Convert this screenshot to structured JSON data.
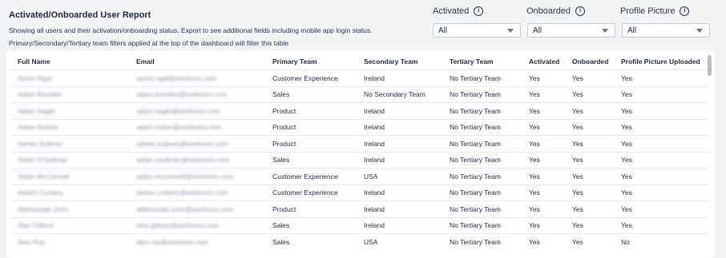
{
  "header": {
    "title": "Activated/Onboarded User Report",
    "description_line1": "Showing all users and their activation/onboarding status. Export to see additional fields including mobile app login status.",
    "description_line2": "Primary/Secondary/Tertiary team filters applied at the top of the dashboard will filter this table"
  },
  "filters": [
    {
      "label": "Activated",
      "value": "All",
      "icon": "info-icon"
    },
    {
      "label": "Onboarded",
      "value": "All",
      "icon": "info-icon"
    },
    {
      "label": "Profile Picture",
      "value": "All",
      "icon": "info-icon"
    }
  ],
  "table": {
    "columns": [
      "Full Name",
      "Email",
      "Primary Team",
      "Secondary Team",
      "Tertiary Team",
      "Activated",
      "Onboarded",
      "Profile Picture Uploaded"
    ],
    "rows": [
      [
        "Aaron Ngal",
        "aaron.ngal@workvivo.com",
        "Customer Experience",
        "Ireland",
        "No Tertiary Team",
        "Yes",
        "Yes",
        "Yes"
      ],
      [
        "Adam Bowden",
        "adam.bowden@workvivo.com",
        "Sales",
        "No Secondary Team",
        "No Tertiary Team",
        "Yes",
        "Yes",
        "Yes"
      ],
      [
        "Adam Nagle",
        "adam.nagle@workvivo.com",
        "Product",
        "Ireland",
        "No Tertiary Team",
        "Yes",
        "Yes",
        "Yes"
      ],
      [
        "Adam Ricken",
        "adam.ricken@workvivo.com",
        "Product",
        "Ireland",
        "No Tertiary Team",
        "Yes",
        "Yes",
        "Yes"
      ],
      [
        "Adrian Sullivan",
        "adrian.sullivan@workvivo.com",
        "Product",
        "Ireland",
        "No Tertiary Team",
        "Yes",
        "Yes",
        "Yes"
      ],
      [
        "Aidan O'Sullivan",
        "aidan.osullivan@workvivo.com",
        "Sales",
        "Ireland",
        "No Tertiary Team",
        "Yes",
        "Yes",
        "Yes"
      ],
      [
        "Aidan McConnell",
        "aidan.mcconnell@workvivo.com",
        "Customer Experience",
        "USA",
        "No Tertiary Team",
        "Yes",
        "Yes",
        "Yes"
      ],
      [
        "Aislinn Corkery",
        "aislinn.corkery@workvivo.com",
        "Customer Experience",
        "Ireland",
        "No Tertiary Team",
        "Yes",
        "Yes",
        "Yes"
      ],
      [
        "Aleksandar Zoric",
        "aleksandar.zoric@workvivo.com",
        "Product",
        "Ireland",
        "No Tertiary Team",
        "Yes",
        "Yes",
        "Yes"
      ],
      [
        "Alex Gillmor",
        "alex.gillmor@workvivo.com",
        "Sales",
        "Ireland",
        "No Tertiary Team",
        "Yes",
        "Yes",
        "Yes"
      ],
      [
        "Alex Roy",
        "alex.roy@workvivo.com",
        "Sales",
        "USA",
        "No Tertiary Team",
        "Yes",
        "Yes",
        "No"
      ]
    ]
  }
}
